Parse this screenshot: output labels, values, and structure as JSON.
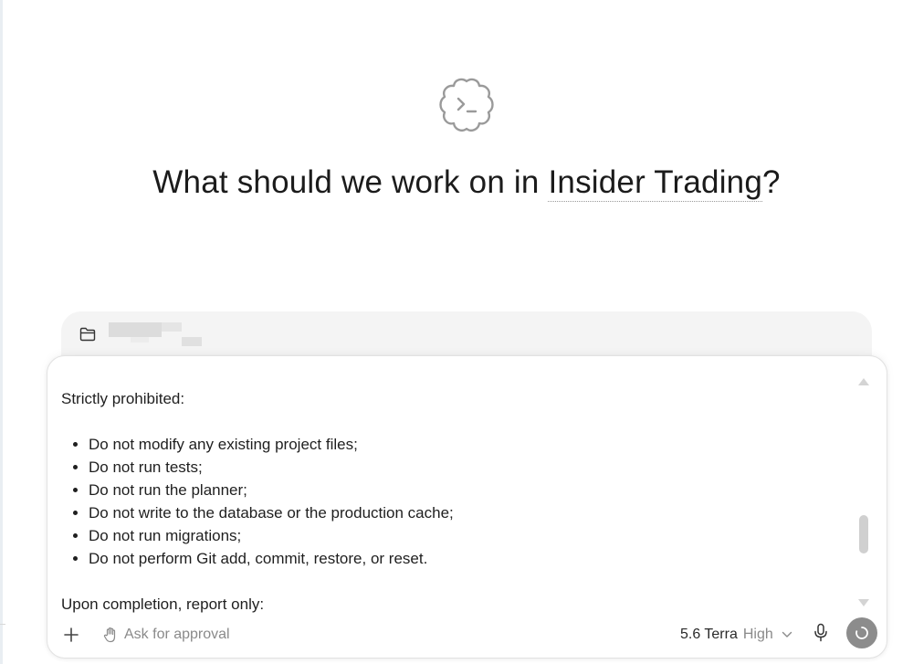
{
  "hero": {
    "prefix": "What should we work on in ",
    "project": "Insider Trading",
    "suffix": "?",
    "logo_icon": "terminal-cloud-icon"
  },
  "workspace": {
    "icon": "folder-icon"
  },
  "composer": {
    "intro": "Strictly prohibited:",
    "prohibited_items": [
      "Do not modify any existing project files;",
      "Do not run tests;",
      "Do not run the planner;",
      "Do not write to the database or the production cache;",
      "Do not run migrations;",
      "Do not perform Git add, commit, restore, or reset."
    ],
    "outro": "Upon completion, report only:"
  },
  "toolbar": {
    "add_label": "+",
    "approval_label": "Ask for approval",
    "model_name": "5.6 Terra",
    "effort_level": "High",
    "icons": {
      "add": "plus-icon",
      "approval": "hand-icon",
      "dropdown": "chevron-down-icon",
      "mic": "microphone-icon",
      "send": "spinner-icon"
    }
  },
  "colors": {
    "send_button": "#8c8c8c",
    "workspace_bg": "#f4f4f4",
    "muted_text": "#8a8a8a"
  }
}
